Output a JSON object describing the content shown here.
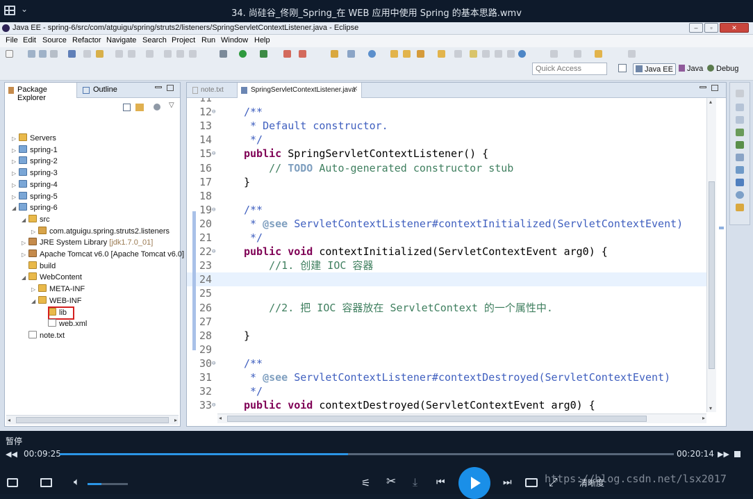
{
  "player": {
    "title": "34. 尚硅谷_佟刚_Spring_在 WEB 应用中使用 Spring 的基本思路.wmv",
    "status": "暂停",
    "time_current": "00:09:25",
    "time_total": "00:20:14",
    "progress": 0.47,
    "volume": 0.35,
    "clarity_label": "清晰度",
    "watermark": "https://blog.csdn.net/lsx2017"
  },
  "window": {
    "title": "Java EE - spring-6/src/com/atguigu/spring/struts2/listeners/SpringServletContextListener.java - Eclipse"
  },
  "menu": [
    "File",
    "Edit",
    "Source",
    "Refactor",
    "Navigate",
    "Search",
    "Project",
    "Run",
    "Window",
    "Help"
  ],
  "toolbar": {
    "quick_access_placeholder": "Quick Access",
    "perspectives": [
      "Java EE",
      "Java",
      "Debug"
    ]
  },
  "left_panel": {
    "tabs": [
      "Package Explorer",
      "Outline"
    ],
    "tree": [
      {
        "label": "Servers",
        "icon": "folder-icon",
        "kind": "fold",
        "indent": 0,
        "arrow": "▷"
      },
      {
        "label": "spring-1",
        "icon": "project-icon",
        "kind": "proj",
        "indent": 0,
        "arrow": "▷"
      },
      {
        "label": "spring-2",
        "icon": "project-icon",
        "kind": "proj",
        "indent": 0,
        "arrow": "▷"
      },
      {
        "label": "spring-3",
        "icon": "project-icon",
        "kind": "proj",
        "indent": 0,
        "arrow": "▷"
      },
      {
        "label": "spring-4",
        "icon": "project-icon",
        "kind": "proj",
        "indent": 0,
        "arrow": "▷"
      },
      {
        "label": "spring-5",
        "icon": "project-icon",
        "kind": "proj",
        "indent": 0,
        "arrow": "▷"
      },
      {
        "label": "spring-6",
        "icon": "project-icon",
        "kind": "proj",
        "indent": 0,
        "arrow": "◢"
      },
      {
        "label": "src",
        "icon": "source-folder-icon",
        "kind": "fold",
        "indent": 1,
        "arrow": "◢"
      },
      {
        "label": "com.atguigu.spring.struts2.listeners",
        "icon": "package-icon",
        "kind": "pkg",
        "indent": 2,
        "arrow": "▷"
      },
      {
        "label": "JRE System Library",
        "suffix": " [jdk1.7.0_01]",
        "icon": "library-icon",
        "kind": "jar",
        "indent": 1,
        "arrow": "▷"
      },
      {
        "label": "Apache Tomcat v6.0 [Apache Tomcat v6.0]",
        "icon": "library-icon",
        "kind": "jar",
        "indent": 1,
        "arrow": "▷"
      },
      {
        "label": "build",
        "icon": "folder-icon",
        "kind": "fold",
        "indent": 1,
        "arrow": ""
      },
      {
        "label": "WebContent",
        "icon": "folder-icon",
        "kind": "fold",
        "indent": 1,
        "arrow": "◢"
      },
      {
        "label": "META-INF",
        "icon": "folder-icon",
        "kind": "fold",
        "indent": 2,
        "arrow": "▷"
      },
      {
        "label": "WEB-INF",
        "icon": "folder-icon",
        "kind": "fold",
        "indent": 2,
        "arrow": "◢"
      },
      {
        "label": "lib",
        "icon": "folder-icon",
        "kind": "fold",
        "indent": 3,
        "arrow": "",
        "selected": true
      },
      {
        "label": "web.xml",
        "icon": "xml-file-icon",
        "kind": "xml",
        "indent": 3,
        "arrow": ""
      },
      {
        "label": "note.txt",
        "icon": "text-file-icon",
        "kind": "txt",
        "indent": 1,
        "arrow": ""
      }
    ]
  },
  "editor": {
    "tabs": [
      "note.txt",
      "SpringServletContextListener.java"
    ],
    "lines": [
      {
        "n": "11",
        "html": ""
      },
      {
        "n": "12",
        "fold": true,
        "html": "<span class='cm'>/**</span>"
      },
      {
        "n": "13",
        "html": "<span class='cm'> * Default constructor.</span>"
      },
      {
        "n": "14",
        "html": "<span class='cm'> */</span>"
      },
      {
        "n": "15",
        "fold": true,
        "html": "<span class='kw'>public</span> SpringServletContextListener() {"
      },
      {
        "n": "16",
        "html": "    <span class='cl'>// </span><span class='task'>TODO</span><span class='cl'> Auto-generated constructor stub</span>"
      },
      {
        "n": "17",
        "html": "}"
      },
      {
        "n": "18",
        "html": ""
      },
      {
        "n": "19",
        "fold": true,
        "html": "<span class='cm'>/**</span>"
      },
      {
        "n": "20",
        "html": "<span class='cm'> * </span><span class='tag'>@see</span><span class='cm'> ServletContextListener#contextInitialized(ServletContextEvent)</span>"
      },
      {
        "n": "21",
        "html": "<span class='cm'> */</span>"
      },
      {
        "n": "22",
        "fold": true,
        "html": "<span class='kw'>public</span> <span class='kw'>void</span> contextInitialized(ServletContextEvent arg0) {"
      },
      {
        "n": "23",
        "html": "    <span class='cl'>//1. 创建 IOC 容器</span>"
      },
      {
        "n": "24",
        "html": "",
        "current": true
      },
      {
        "n": "25",
        "html": ""
      },
      {
        "n": "26",
        "html": "    <span class='cl'>//2. 把 IOC 容器放在 ServletContext 的一个属性中.</span>"
      },
      {
        "n": "27",
        "html": ""
      },
      {
        "n": "28",
        "html": "}"
      },
      {
        "n": "29",
        "html": ""
      },
      {
        "n": "30",
        "fold": true,
        "html": "<span class='cm'>/**</span>"
      },
      {
        "n": "31",
        "html": "<span class='cm'> * </span><span class='tag'>@see</span><span class='cm'> ServletContextListener#contextDestroyed(ServletContextEvent)</span>"
      },
      {
        "n": "32",
        "html": "<span class='cm'> */</span>"
      },
      {
        "n": "33",
        "fold": true,
        "html": "<span class='kw'>public</span> <span class='kw'>void</span> contextDestroyed(ServletContextEvent arg0) {"
      }
    ]
  }
}
